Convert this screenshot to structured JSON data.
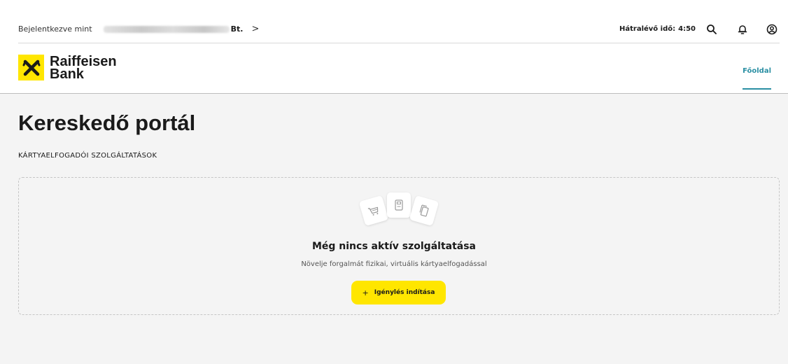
{
  "header": {
    "user_prefix": "Bejelentkezve mint",
    "user_suffix": "Bt.",
    "timer_label": "Hátralévő idő:",
    "timer_value": "4:50"
  },
  "brand": {
    "name_line1": "Raiffeisen",
    "name_line2": "Bank",
    "color": "#ffe600"
  },
  "nav": {
    "home": "Főoldal",
    "accent_color": "#2a8fa3"
  },
  "main": {
    "title": "Kereskedő portál",
    "section_label": "KÁRTYAELFOGADÓI SZOLGÁLTATÁSOK",
    "empty_title": "Még nincs aktív szolgáltatása",
    "empty_subtitle": "Növelje forgalmát fizikai, virtuális kártyaelfogadással",
    "cta_plus": "+",
    "cta_label": "Igénylés indítása"
  },
  "icons": {
    "user_chevron": ">",
    "search": "search-icon",
    "notifications": "bell-icon",
    "profile": "user-circle-icon",
    "card_1": "shopping-cart-icon",
    "card_2": "pos-terminal-icon",
    "card_3": "card-stack-icon"
  }
}
